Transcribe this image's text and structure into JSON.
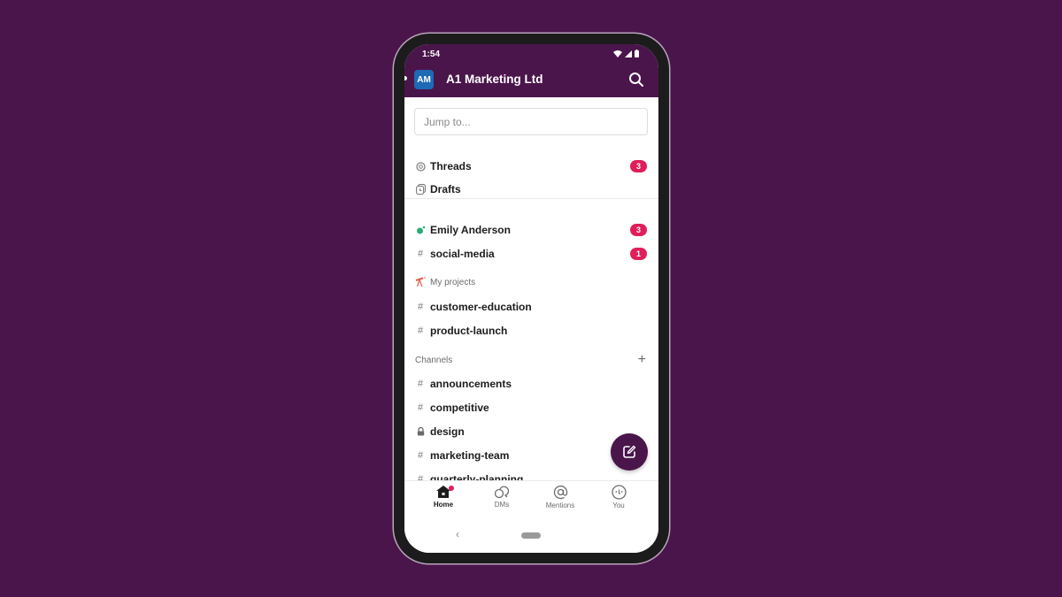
{
  "status_bar": {
    "time": "1:54"
  },
  "header": {
    "workspace_initials": "AM",
    "workspace_name": "A1 Marketing Ltd",
    "search_icon": "search-icon"
  },
  "search": {
    "placeholder": "Jump to..."
  },
  "top_items": [
    {
      "icon": "threads-icon",
      "label": "Threads",
      "badge": "3"
    },
    {
      "icon": "drafts-icon",
      "label": "Drafts",
      "badge": null
    }
  ],
  "unreads": [
    {
      "icon": "dm-presence-icon",
      "label": "Emily Anderson",
      "badge": "3"
    },
    {
      "icon": "hash-icon",
      "label": "social-media",
      "badge": "1"
    }
  ],
  "sections": [
    {
      "title": "My projects",
      "icon": "telescope-icon",
      "items": [
        {
          "icon": "hash-icon",
          "label": "customer-education"
        },
        {
          "icon": "hash-icon",
          "label": "product-launch"
        }
      ]
    },
    {
      "title": "Channels",
      "add_icon": "plus-icon",
      "items": [
        {
          "icon": "hash-icon",
          "label": "announcements"
        },
        {
          "icon": "hash-icon",
          "label": "competitive"
        },
        {
          "icon": "lock-icon",
          "label": "design"
        },
        {
          "icon": "hash-icon",
          "label": "marketing-team"
        },
        {
          "icon": "hash-icon",
          "label": "quarterly-planning"
        }
      ]
    }
  ],
  "fab": {
    "icon": "compose-icon"
  },
  "bottom_nav": [
    {
      "label": "Home",
      "icon": "home-icon",
      "active": true,
      "dot": true
    },
    {
      "label": "DMs",
      "icon": "dms-icon",
      "active": false
    },
    {
      "label": "Mentions",
      "icon": "mentions-icon",
      "active": false
    },
    {
      "label": "You",
      "icon": "you-icon",
      "active": false
    }
  ],
  "colors": {
    "brand": "#4a154b",
    "badge": "#e01e5a",
    "avatar": "#1e6ab4",
    "presence": "#2bac76"
  }
}
